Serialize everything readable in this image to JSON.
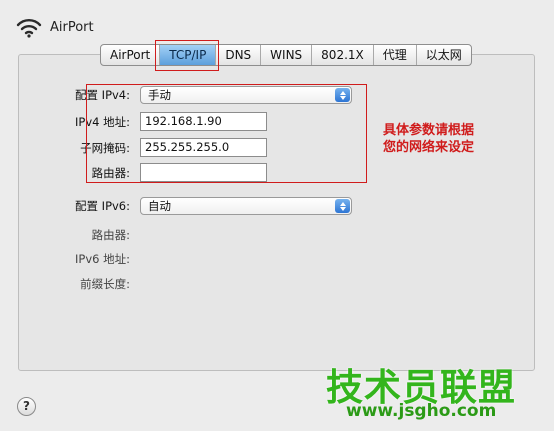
{
  "header": {
    "title": "AirPort",
    "icon": "wifi-icon"
  },
  "tabs": [
    {
      "label": "AirPort",
      "active": false
    },
    {
      "label": "TCP/IP",
      "active": true
    },
    {
      "label": "DNS",
      "active": false
    },
    {
      "label": "WINS",
      "active": false
    },
    {
      "label": "802.1X",
      "active": false
    },
    {
      "label": "代理",
      "active": false
    },
    {
      "label": "以太网",
      "active": false
    }
  ],
  "ipv4": {
    "configure_label": "配置 IPv4:",
    "configure_value": "手动",
    "address_label": "IPv4 地址:",
    "address_value": "192.168.1.90",
    "subnet_label": "子网掩码:",
    "subnet_value": "255.255.255.0",
    "router_label": "路由器:",
    "router_value": ""
  },
  "ipv6": {
    "configure_label": "配置 IPv6:",
    "configure_value": "自动",
    "router_label": "路由器:",
    "address_label": "IPv6 地址:",
    "prefix_label": "前缀长度:"
  },
  "annotation": {
    "line1": "具体参数请根据",
    "line2": "您的网络来设定"
  },
  "watermark": {
    "text": "技术员联盟",
    "url": "www.jsgho.com"
  },
  "colors": {
    "highlight": "#d01c1c",
    "accent": "#2d75d4",
    "watermark": "#33b51c"
  }
}
